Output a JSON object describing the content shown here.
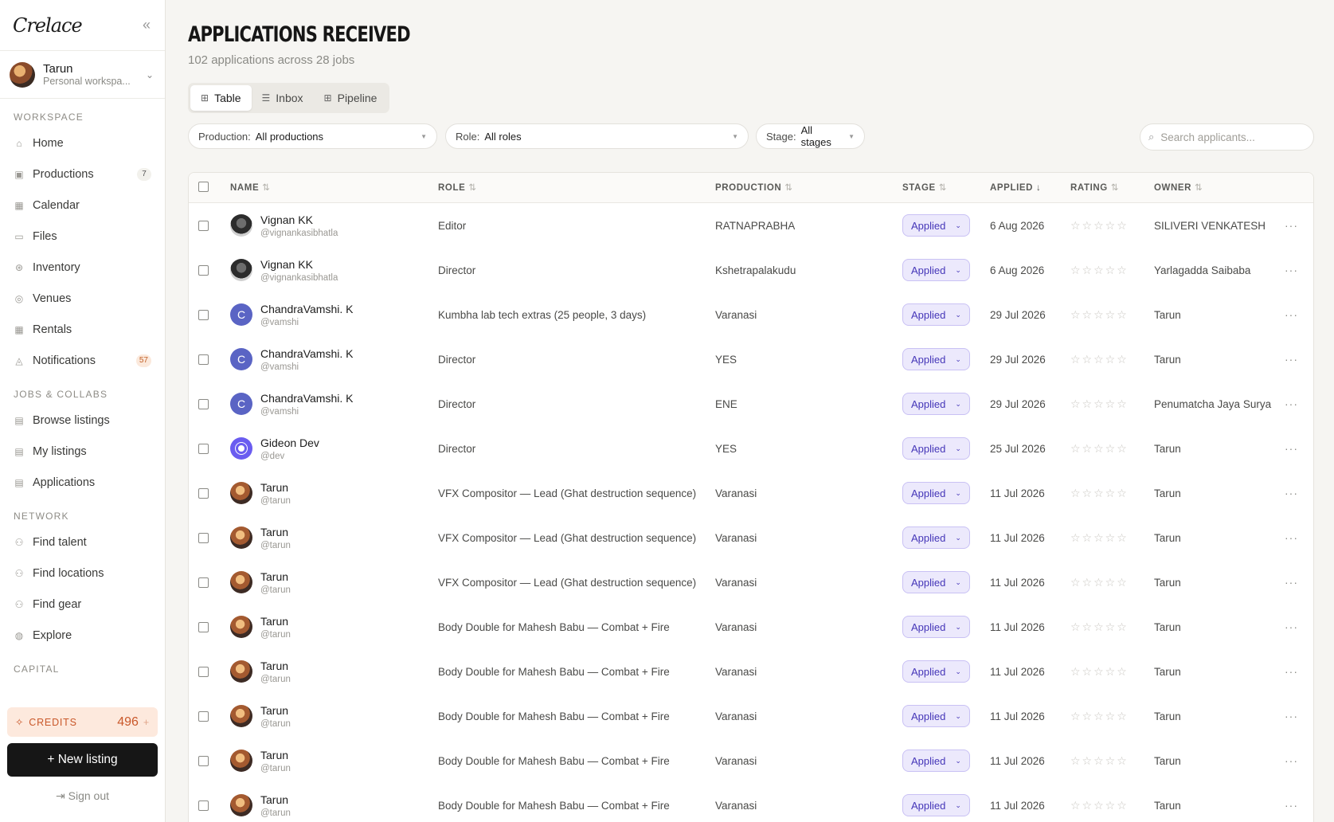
{
  "app": {
    "logo": "Crelace",
    "collapse_icon": "«"
  },
  "user": {
    "name": "Tarun",
    "workspace": "Personal workspa..."
  },
  "nav": {
    "workspace_label": "WORKSPACE",
    "workspace_items": [
      {
        "label": "Home",
        "icon": "home-icon",
        "glyph": "⌂"
      },
      {
        "label": "Productions",
        "icon": "folder-icon",
        "glyph": "▣",
        "badge": "7"
      },
      {
        "label": "Calendar",
        "icon": "calendar-icon",
        "glyph": "▦"
      },
      {
        "label": "Files",
        "icon": "file-icon",
        "glyph": "▭"
      },
      {
        "label": "Inventory",
        "icon": "box-icon",
        "glyph": "⊛"
      },
      {
        "label": "Venues",
        "icon": "pin-icon",
        "glyph": "◎"
      },
      {
        "label": "Rentals",
        "icon": "calendar-icon",
        "glyph": "▦"
      },
      {
        "label": "Notifications",
        "icon": "bell-icon",
        "glyph": "◬",
        "badge": "57"
      }
    ],
    "jobs_label": "JOBS & COLLABS",
    "jobs_items": [
      {
        "label": "Browse listings",
        "icon": "briefcase-icon",
        "glyph": "▤"
      },
      {
        "label": "My listings",
        "icon": "briefcase-icon",
        "glyph": "▤"
      },
      {
        "label": "Applications",
        "icon": "briefcase-icon",
        "glyph": "▤"
      }
    ],
    "network_label": "NETWORK",
    "network_items": [
      {
        "label": "Find talent",
        "icon": "people-icon",
        "glyph": "⚇"
      },
      {
        "label": "Find locations",
        "icon": "people-icon",
        "glyph": "⚇"
      },
      {
        "label": "Find gear",
        "icon": "people-icon",
        "glyph": "⚇"
      },
      {
        "label": "Explore",
        "icon": "compass-icon",
        "glyph": "◍"
      }
    ],
    "capital_label": "CAPITAL"
  },
  "credits": {
    "label": "CREDITS",
    "value": "496",
    "plus": "+"
  },
  "new_listing": "+  New listing",
  "sign_out": "Sign out",
  "page": {
    "title": "APPLICATIONS RECEIVED",
    "subtitle": "102 applications across 28 jobs",
    "tabs": [
      {
        "label": "Table",
        "glyph": "⊞",
        "active": true
      },
      {
        "label": "Inbox",
        "glyph": "☰",
        "active": false
      },
      {
        "label": "Pipeline",
        "glyph": "⊞",
        "active": false
      }
    ]
  },
  "filters": {
    "production": {
      "key": "Production:",
      "value": "All productions"
    },
    "role": {
      "key": "Role:",
      "value": "All roles"
    },
    "stage": {
      "key": "Stage:",
      "value": "All stages"
    },
    "search_placeholder": "Search applicants..."
  },
  "table": {
    "headers": {
      "name": "NAME",
      "role": "ROLE",
      "production": "PRODUCTION",
      "stage": "STAGE",
      "applied": "APPLIED",
      "rating": "RATING",
      "owner": "OWNER"
    },
    "stars": "☆☆☆☆☆",
    "more": "···",
    "stage_chev": "⌄",
    "rows": [
      {
        "name": "Vignan KK",
        "handle": "@vignankasibhatla",
        "avatar": "grey",
        "role": "Editor",
        "production": "RATNAPRABHA",
        "stage": "Applied",
        "applied": "6 Aug 2026",
        "owner": "SILIVERI VENKATESH"
      },
      {
        "name": "Vignan KK",
        "handle": "@vignankasibhatla",
        "avatar": "grey",
        "role": "Director",
        "production": "Kshetrapalakudu",
        "stage": "Applied",
        "applied": "6 Aug 2026",
        "owner": "Yarlagadda Saibaba"
      },
      {
        "name": "ChandraVamshi. K",
        "handle": "@vamshi",
        "avatar": "letter",
        "initial": "C",
        "role": "Kumbha lab tech extras (25 people, 3 days)",
        "production": "Varanasi",
        "stage": "Applied",
        "applied": "29 Jul 2026",
        "owner": "Tarun"
      },
      {
        "name": "ChandraVamshi. K",
        "handle": "@vamshi",
        "avatar": "letter",
        "initial": "C",
        "role": "Director",
        "production": "YES",
        "stage": "Applied",
        "applied": "29 Jul 2026",
        "owner": "Tarun"
      },
      {
        "name": "ChandraVamshi. K",
        "handle": "@vamshi",
        "avatar": "letter",
        "initial": "C",
        "role": "Director",
        "production": "ENE",
        "stage": "Applied",
        "applied": "29 Jul 2026",
        "owner": "Penumatcha Jaya Surya"
      },
      {
        "name": "Gideon Dev",
        "handle": "@dev",
        "avatar": "gid",
        "role": "Director",
        "production": "YES",
        "stage": "Applied",
        "applied": "25 Jul 2026",
        "owner": "Tarun"
      },
      {
        "name": "Tarun",
        "handle": "@tarun",
        "avatar": "photo",
        "role": "VFX Compositor — Lead (Ghat destruction sequence)",
        "production": "Varanasi",
        "stage": "Applied",
        "applied": "11 Jul 2026",
        "owner": "Tarun"
      },
      {
        "name": "Tarun",
        "handle": "@tarun",
        "avatar": "photo",
        "role": "VFX Compositor — Lead (Ghat destruction sequence)",
        "production": "Varanasi",
        "stage": "Applied",
        "applied": "11 Jul 2026",
        "owner": "Tarun"
      },
      {
        "name": "Tarun",
        "handle": "@tarun",
        "avatar": "photo",
        "role": "VFX Compositor — Lead (Ghat destruction sequence)",
        "production": "Varanasi",
        "stage": "Applied",
        "applied": "11 Jul 2026",
        "owner": "Tarun"
      },
      {
        "name": "Tarun",
        "handle": "@tarun",
        "avatar": "photo",
        "role": "Body Double for Mahesh Babu — Combat + Fire",
        "production": "Varanasi",
        "stage": "Applied",
        "applied": "11 Jul 2026",
        "owner": "Tarun"
      },
      {
        "name": "Tarun",
        "handle": "@tarun",
        "avatar": "photo",
        "role": "Body Double for Mahesh Babu — Combat + Fire",
        "production": "Varanasi",
        "stage": "Applied",
        "applied": "11 Jul 2026",
        "owner": "Tarun"
      },
      {
        "name": "Tarun",
        "handle": "@tarun",
        "avatar": "photo",
        "role": "Body Double for Mahesh Babu — Combat + Fire",
        "production": "Varanasi",
        "stage": "Applied",
        "applied": "11 Jul 2026",
        "owner": "Tarun"
      },
      {
        "name": "Tarun",
        "handle": "@tarun",
        "avatar": "photo",
        "role": "Body Double for Mahesh Babu — Combat + Fire",
        "production": "Varanasi",
        "stage": "Applied",
        "applied": "11 Jul 2026",
        "owner": "Tarun"
      },
      {
        "name": "Tarun",
        "handle": "@tarun",
        "avatar": "photo",
        "role": "Body Double for Mahesh Babu — Combat + Fire",
        "production": "Varanasi",
        "stage": "Applied",
        "applied": "11 Jul 2026",
        "owner": "Tarun"
      }
    ]
  }
}
